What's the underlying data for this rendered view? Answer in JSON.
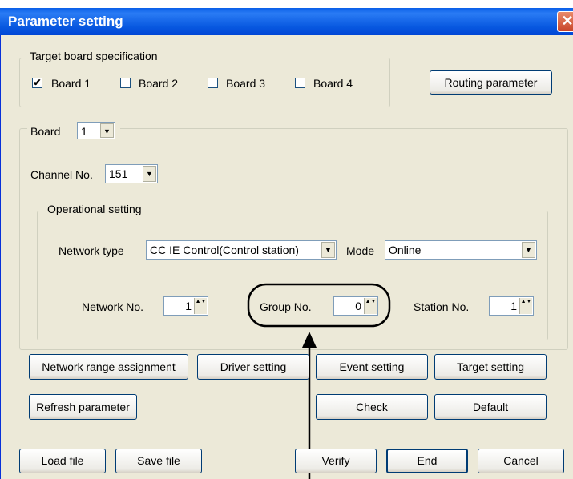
{
  "window": {
    "title": "Parameter setting",
    "close": "✕"
  },
  "target_board": {
    "legend": "Target board specification",
    "boards": [
      {
        "label": "Board 1",
        "checked": true
      },
      {
        "label": "Board 2",
        "checked": false
      },
      {
        "label": "Board 3",
        "checked": false
      },
      {
        "label": "Board 4",
        "checked": false
      }
    ],
    "routing_button": "Routing parameter"
  },
  "board": {
    "label": "Board",
    "value": "1"
  },
  "channel": {
    "label": "Channel No.",
    "value": "151"
  },
  "operational": {
    "legend": "Operational setting",
    "network_type_label": "Network type",
    "network_type_value": "CC IE Control(Control station)",
    "mode_label": "Mode",
    "mode_value": "Online",
    "network_no_label": "Network No.",
    "network_no_value": "1",
    "group_no_label": "Group No.",
    "group_no_value": "0",
    "station_no_label": "Station No.",
    "station_no_value": "1"
  },
  "buttons": {
    "network_range": "Network range assignment",
    "driver": "Driver setting",
    "event": "Event setting",
    "target": "Target setting",
    "refresh": "Refresh parameter",
    "check": "Check",
    "default": "Default",
    "load": "Load file",
    "save": "Save file",
    "verify": "Verify",
    "end": "End",
    "cancel": "Cancel"
  },
  "icons": {
    "check": "✔",
    "dropdown": "▼",
    "spin": "▲▼"
  }
}
